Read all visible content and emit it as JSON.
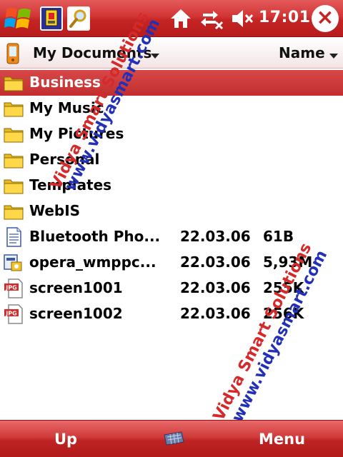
{
  "titlebar": {
    "time": "17:01",
    "close_label": "×"
  },
  "folderbar": {
    "folder_name": "My Documents",
    "sort_by": "Name"
  },
  "files": [
    {
      "name": "Business",
      "date": "",
      "size": "",
      "icon": "folder-icon",
      "selected": true
    },
    {
      "name": "My Music",
      "date": "",
      "size": "",
      "icon": "folder-icon"
    },
    {
      "name": "My Pictures",
      "date": "",
      "size": "",
      "icon": "folder-icon"
    },
    {
      "name": "Personal",
      "date": "",
      "size": "",
      "icon": "folder-icon"
    },
    {
      "name": "Templates",
      "date": "",
      "size": "",
      "icon": "folder-icon"
    },
    {
      "name": "WebIS",
      "date": "",
      "size": "",
      "icon": "folder-icon"
    },
    {
      "name": "Bluetooth Pho...",
      "date": "22.03.06",
      "size": "61B",
      "icon": "document-icon"
    },
    {
      "name": "opera_wmppc...",
      "date": "22.03.06",
      "size": "5,93M",
      "icon": "installer-icon"
    },
    {
      "name": "screen1001",
      "date": "22.03.06",
      "size": "255K",
      "icon": "jpg-file-icon"
    },
    {
      "name": "screen1002",
      "date": "22.03.06",
      "size": "256K",
      "icon": "jpg-file-icon"
    }
  ],
  "watermarks": {
    "red_text": "Vidya Smart Solutions",
    "blue_text": "www.vidyasmart.com"
  },
  "softkeys": {
    "left": "Up",
    "right": "Menu"
  },
  "colors": {
    "theme_red": "#c42424",
    "selection_red": "#d03a3a"
  }
}
